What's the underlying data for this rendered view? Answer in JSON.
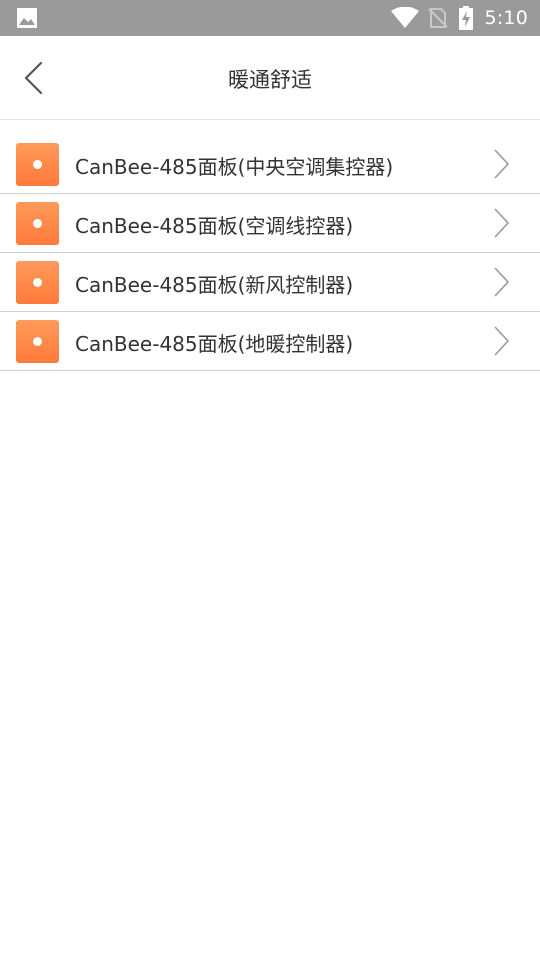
{
  "status_bar": {
    "time": "5:10",
    "icons": [
      "gallery-icon",
      "wifi-icon",
      "no-sim-signal-icon",
      "battery-charging-icon"
    ]
  },
  "header": {
    "title": "暖通舒适",
    "back_icon": "chevron-left-icon"
  },
  "device_list": {
    "items": [
      {
        "label": "CanBee-485面板(中央空调集控器)",
        "icon": "orange-device-icon"
      },
      {
        "label": "CanBee-485面板(空调线控器)",
        "icon": "orange-device-icon"
      },
      {
        "label": "CanBee-485面板(新风控制器)",
        "icon": "orange-device-icon"
      },
      {
        "label": "CanBee-485面板(地暖控制器)",
        "icon": "orange-device-icon"
      }
    ]
  },
  "colors": {
    "status_bar": "#9a9a9a",
    "accent_orange": "#ff8a48",
    "divider": "#cfcfcf",
    "text": "#333333"
  }
}
